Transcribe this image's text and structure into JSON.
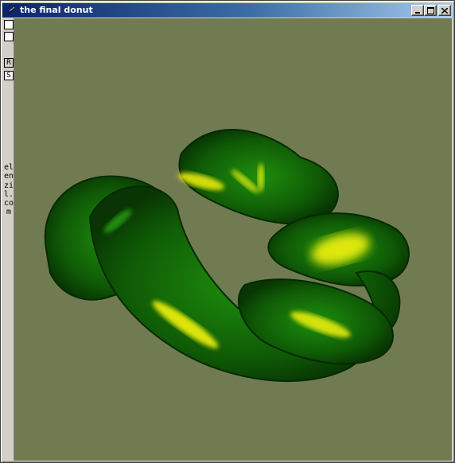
{
  "window": {
    "title": "the final donut",
    "icon": "app-quill-icon",
    "controls": [
      "minimize-icon",
      "maximize-icon",
      "close-icon"
    ]
  },
  "sidebar": {
    "button_3_label": "R",
    "button_4_label": "S",
    "vertical_text": "elenzil.com"
  },
  "viewport": {
    "background": "#717b51",
    "shape": "twisted torus knot",
    "colors": {
      "dark_green": "#0b3f04",
      "mid_green": "#1e8f0d",
      "highlight_yellow": "#f3f20a"
    }
  }
}
